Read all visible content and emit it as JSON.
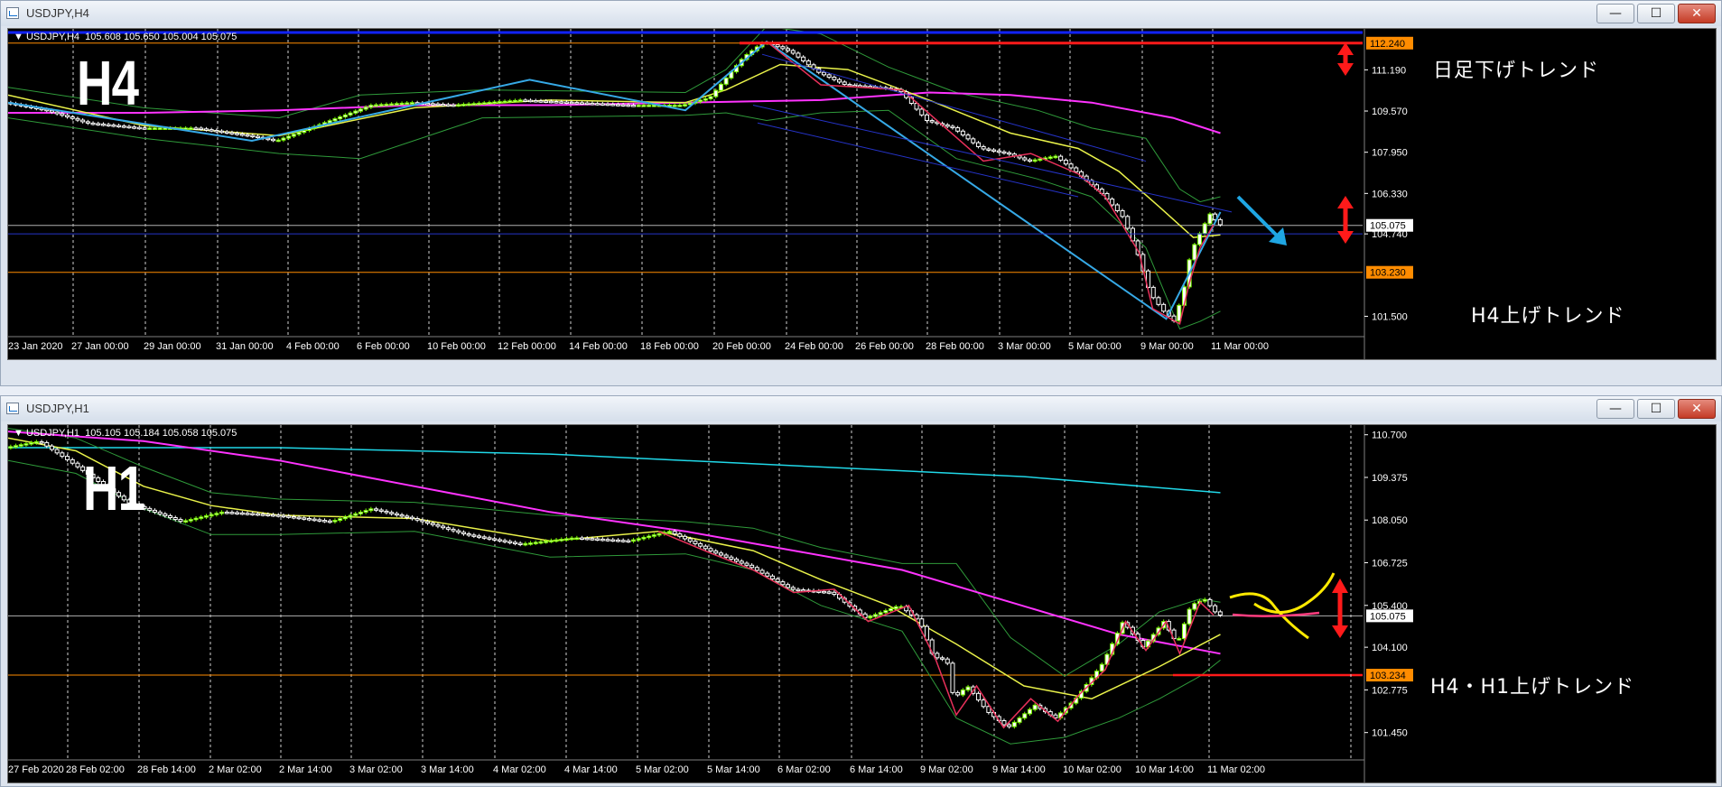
{
  "colors": {
    "background": "#000000",
    "price_up": "#7cfc00",
    "price_down": "#ffffff",
    "ma_fast": "#e9f24a",
    "ma_slow": "#ff33ff",
    "ma_long_h1": "#20d8e8",
    "bollinger": "#2f9a3a",
    "zigzag_h4": "#36a9e6",
    "zigzag_minor": "#e8305a",
    "channel": "#2533c8",
    "resistance": "#ff1a1a",
    "support": "#ff8c00",
    "current_price_line": "#b0b0b0",
    "annotation_arrow_red": "#ff1a1a",
    "annotation_arrow_blue": "#1fa6e3",
    "forecast_yellow": "#ffea00",
    "forecast_pink": "#ff3d7f"
  },
  "icons": {
    "app": "chart-window-icon",
    "minimize": "minimize-icon",
    "maximize": "maximize-icon",
    "close": "close-icon",
    "symbol_dropdown": "triangle-down-icon"
  },
  "windows": [
    {
      "id": "h4",
      "title": "USDJPY,H4",
      "symbol_line": "USDJPY,H4  105.608 105.650 105.004 105.075",
      "timeframe_label": "H4",
      "buttons": {
        "minimize": "—",
        "maximize": "☐",
        "close": "✕"
      },
      "price_axis": {
        "min": 100.7,
        "max": 112.8,
        "ticks": [
          "111.190",
          "109.570",
          "107.950",
          "106.330",
          "104.740",
          "101.500"
        ],
        "tick_values": [
          111.19,
          109.57,
          107.95,
          106.33,
          104.74,
          101.5
        ],
        "tags": [
          {
            "label": "112.240",
            "value": 112.24,
            "bg": "#ff8c00",
            "fg": "#000000"
          },
          {
            "label": "105.075",
            "value": 105.075,
            "bg": "#ffffff",
            "fg": "#000000"
          },
          {
            "label": "103.230",
            "value": 103.23,
            "bg": "#ff8c00",
            "fg": "#000000"
          }
        ]
      },
      "time_axis": [
        "23 Jan 2020",
        "27 Jan 00:00",
        "29 Jan 00:00",
        "31 Jan 00:00",
        "4 Feb 00:00",
        "6 Feb 00:00",
        "10 Feb 00:00",
        "12 Feb 00:00",
        "14 Feb 00:00",
        "18 Feb 00:00",
        "20 Feb 00:00",
        "24 Feb 00:00",
        "26 Feb 00:00",
        "28 Feb 00:00",
        "3 Mar 00:00",
        "5 Mar 00:00",
        "9 Mar 00:00",
        "11 Mar 00:00"
      ],
      "annotations": {
        "upper": "日足下げトレンド",
        "lower": "H4上げトレンド"
      },
      "levels": {
        "resistance": 112.24,
        "support": 103.23,
        "current": 105.075,
        "channel_line": 104.74
      },
      "price_path": [
        [
          0,
          109.9
        ],
        [
          0.03,
          109.6
        ],
        [
          0.06,
          109.1
        ],
        [
          0.1,
          108.9
        ],
        [
          0.14,
          108.9
        ],
        [
          0.18,
          108.6
        ],
        [
          0.2,
          108.4
        ],
        [
          0.24,
          109.2
        ],
        [
          0.27,
          109.8
        ],
        [
          0.3,
          109.9
        ],
        [
          0.33,
          109.8
        ],
        [
          0.38,
          110.0
        ],
        [
          0.42,
          109.9
        ],
        [
          0.46,
          109.8
        ],
        [
          0.5,
          109.8
        ],
        [
          0.52,
          110.1
        ],
        [
          0.545,
          111.7
        ],
        [
          0.56,
          112.3
        ],
        [
          0.58,
          111.9
        ],
        [
          0.6,
          111.1
        ],
        [
          0.62,
          110.6
        ],
        [
          0.645,
          110.5
        ],
        [
          0.66,
          110.4
        ],
        [
          0.68,
          109.2
        ],
        [
          0.7,
          108.9
        ],
        [
          0.72,
          108.1
        ],
        [
          0.74,
          107.9
        ],
        [
          0.755,
          107.6
        ],
        [
          0.775,
          107.8
        ],
        [
          0.79,
          107.2
        ],
        [
          0.81,
          106.3
        ],
        [
          0.825,
          105.4
        ],
        [
          0.835,
          104.1
        ],
        [
          0.845,
          102.4
        ],
        [
          0.855,
          101.7
        ],
        [
          0.863,
          101.3
        ],
        [
          0.87,
          102.6
        ],
        [
          0.875,
          104.0
        ],
        [
          0.882,
          104.8
        ],
        [
          0.89,
          105.6
        ],
        [
          0.895,
          105.1
        ]
      ],
      "ma_fast": [
        [
          0,
          110.2
        ],
        [
          0.1,
          109.0
        ],
        [
          0.2,
          108.6
        ],
        [
          0.3,
          109.7
        ],
        [
          0.4,
          110.0
        ],
        [
          0.5,
          109.9
        ],
        [
          0.53,
          110.4
        ],
        [
          0.57,
          111.4
        ],
        [
          0.62,
          111.2
        ],
        [
          0.68,
          110.0
        ],
        [
          0.74,
          108.7
        ],
        [
          0.79,
          108.1
        ],
        [
          0.82,
          107.2
        ],
        [
          0.85,
          105.8
        ],
        [
          0.875,
          104.6
        ],
        [
          0.895,
          104.7
        ]
      ],
      "ma_slow": [
        [
          0,
          109.5
        ],
        [
          0.1,
          109.5
        ],
        [
          0.2,
          109.6
        ],
        [
          0.3,
          109.8
        ],
        [
          0.4,
          109.8
        ],
        [
          0.5,
          109.9
        ],
        [
          0.6,
          110.0
        ],
        [
          0.68,
          110.3
        ],
        [
          0.74,
          110.2
        ],
        [
          0.8,
          109.9
        ],
        [
          0.86,
          109.3
        ],
        [
          0.895,
          108.7
        ]
      ],
      "bb_upper": [
        [
          0,
          110.5
        ],
        [
          0.1,
          109.7
        ],
        [
          0.2,
          109.3
        ],
        [
          0.26,
          110.2
        ],
        [
          0.35,
          110.4
        ],
        [
          0.5,
          110.3
        ],
        [
          0.53,
          111.2
        ],
        [
          0.56,
          112.9
        ],
        [
          0.6,
          112.6
        ],
        [
          0.65,
          111.3
        ],
        [
          0.7,
          110.3
        ],
        [
          0.76,
          109.6
        ],
        [
          0.8,
          108.9
        ],
        [
          0.84,
          108.5
        ],
        [
          0.865,
          106.5
        ],
        [
          0.88,
          106.0
        ],
        [
          0.895,
          106.2
        ]
      ],
      "bb_lower": [
        [
          0,
          109.3
        ],
        [
          0.1,
          108.5
        ],
        [
          0.2,
          107.9
        ],
        [
          0.26,
          107.7
        ],
        [
          0.35,
          109.3
        ],
        [
          0.5,
          109.4
        ],
        [
          0.53,
          109.5
        ],
        [
          0.56,
          109.2
        ],
        [
          0.6,
          109.5
        ],
        [
          0.65,
          109.6
        ],
        [
          0.7,
          107.7
        ],
        [
          0.76,
          106.9
        ],
        [
          0.8,
          106.2
        ],
        [
          0.84,
          104.2
        ],
        [
          0.865,
          101.0
        ],
        [
          0.88,
          101.3
        ],
        [
          0.895,
          101.7
        ]
      ],
      "zigzag": [
        [
          0,
          109.9
        ],
        [
          0.18,
          108.4
        ],
        [
          0.385,
          110.8
        ],
        [
          0.5,
          109.6
        ],
        [
          0.56,
          112.3
        ],
        [
          0.855,
          101.4
        ],
        [
          0.895,
          105.6
        ]
      ],
      "zigzag_minor": [
        [
          0.56,
          112.3
        ],
        [
          0.6,
          110.6
        ],
        [
          0.66,
          110.4
        ],
        [
          0.72,
          107.6
        ],
        [
          0.755,
          107.9
        ],
        [
          0.79,
          107.1
        ],
        [
          0.81,
          106.2
        ],
        [
          0.835,
          104.0
        ],
        [
          0.845,
          101.8
        ],
        [
          0.865,
          101.2
        ],
        [
          0.872,
          102.8
        ],
        [
          0.88,
          104.2
        ],
        [
          0.89,
          105.1
        ]
      ]
    },
    {
      "id": "h1",
      "title": "USDJPY,H1",
      "symbol_line": "USDJPY,H1  105.105 105.184 105.058 105.075",
      "timeframe_label": "H1",
      "buttons": {
        "minimize": "—",
        "maximize": "☐",
        "close": "✕"
      },
      "price_axis": {
        "min": 100.6,
        "max": 111.0,
        "ticks": [
          "110.700",
          "109.375",
          "108.050",
          "106.725",
          "105.400",
          "104.100",
          "102.775",
          "101.450"
        ],
        "tick_values": [
          110.7,
          109.375,
          108.05,
          106.725,
          105.4,
          104.1,
          102.775,
          101.45
        ],
        "tags": [
          {
            "label": "105.075",
            "value": 105.075,
            "bg": "#ffffff",
            "fg": "#000000"
          },
          {
            "label": "103.234",
            "value": 103.234,
            "bg": "#ff8c00",
            "fg": "#000000"
          }
        ]
      },
      "time_axis": [
        "27 Feb 2020",
        "28 Feb 02:00",
        "28 Feb 14:00",
        "2 Mar 02:00",
        "2 Mar 14:00",
        "3 Mar 02:00",
        "3 Mar 14:00",
        "4 Mar 02:00",
        "4 Mar 14:00",
        "5 Mar 02:00",
        "5 Mar 14:00",
        "6 Mar 02:00",
        "6 Mar 14:00",
        "9 Mar 02:00",
        "9 Mar 14:00",
        "10 Mar 02:00",
        "10 Mar 14:00",
        "11 Mar 02:00"
      ],
      "annotations": {
        "lower": "H4・H1上げトレンド"
      },
      "levels": {
        "support": 103.234,
        "current": 105.075
      },
      "price_path": [
        [
          0,
          110.3
        ],
        [
          0.025,
          110.5
        ],
        [
          0.05,
          109.8
        ],
        [
          0.09,
          108.6
        ],
        [
          0.13,
          108.0
        ],
        [
          0.16,
          108.3
        ],
        [
          0.2,
          108.2
        ],
        [
          0.24,
          108.0
        ],
        [
          0.27,
          108.4
        ],
        [
          0.3,
          108.1
        ],
        [
          0.34,
          107.6
        ],
        [
          0.38,
          107.3
        ],
        [
          0.42,
          107.5
        ],
        [
          0.46,
          107.4
        ],
        [
          0.49,
          107.7
        ],
        [
          0.52,
          107.1
        ],
        [
          0.55,
          106.6
        ],
        [
          0.58,
          105.9
        ],
        [
          0.61,
          105.8
        ],
        [
          0.635,
          105.0
        ],
        [
          0.66,
          105.4
        ],
        [
          0.675,
          104.9
        ],
        [
          0.685,
          103.8
        ],
        [
          0.695,
          103.7
        ],
        [
          0.7,
          102.5
        ],
        [
          0.71,
          102.9
        ],
        [
          0.725,
          102.1
        ],
        [
          0.74,
          101.6
        ],
        [
          0.76,
          102.3
        ],
        [
          0.775,
          101.9
        ],
        [
          0.79,
          102.5
        ],
        [
          0.81,
          103.6
        ],
        [
          0.825,
          104.9
        ],
        [
          0.84,
          104.1
        ],
        [
          0.855,
          104.9
        ],
        [
          0.865,
          104.2
        ],
        [
          0.875,
          105.4
        ],
        [
          0.885,
          105.6
        ],
        [
          0.895,
          105.1
        ]
      ],
      "ma_fast": [
        [
          0,
          110.6
        ],
        [
          0.05,
          110.2
        ],
        [
          0.1,
          109.1
        ],
        [
          0.15,
          108.5
        ],
        [
          0.2,
          108.2
        ],
        [
          0.3,
          108.1
        ],
        [
          0.4,
          107.4
        ],
        [
          0.48,
          107.7
        ],
        [
          0.55,
          107.1
        ],
        [
          0.6,
          106.2
        ],
        [
          0.65,
          105.4
        ],
        [
          0.7,
          104.2
        ],
        [
          0.75,
          102.9
        ],
        [
          0.8,
          102.5
        ],
        [
          0.85,
          103.5
        ],
        [
          0.895,
          104.5
        ]
      ],
      "ma_slow": [
        [
          0,
          110.8
        ],
        [
          0.1,
          110.5
        ],
        [
          0.2,
          109.9
        ],
        [
          0.3,
          109.1
        ],
        [
          0.4,
          108.3
        ],
        [
          0.5,
          107.7
        ],
        [
          0.58,
          107.1
        ],
        [
          0.66,
          106.5
        ],
        [
          0.74,
          105.5
        ],
        [
          0.82,
          104.5
        ],
        [
          0.895,
          103.9
        ]
      ],
      "ma_long": [
        [
          0,
          110.3
        ],
        [
          0.2,
          110.3
        ],
        [
          0.4,
          110.1
        ],
        [
          0.6,
          109.7
        ],
        [
          0.75,
          109.4
        ],
        [
          0.895,
          108.9
        ]
      ],
      "bb_upper": [
        [
          0,
          110.9
        ],
        [
          0.05,
          110.6
        ],
        [
          0.1,
          109.7
        ],
        [
          0.15,
          108.9
        ],
        [
          0.2,
          108.7
        ],
        [
          0.3,
          108.6
        ],
        [
          0.4,
          108.2
        ],
        [
          0.5,
          108.0
        ],
        [
          0.55,
          107.8
        ],
        [
          0.6,
          107.2
        ],
        [
          0.66,
          106.7
        ],
        [
          0.7,
          106.7
        ],
        [
          0.74,
          104.4
        ],
        [
          0.78,
          103.2
        ],
        [
          0.82,
          104.2
        ],
        [
          0.85,
          105.2
        ],
        [
          0.88,
          105.6
        ],
        [
          0.895,
          105.5
        ]
      ],
      "bb_lower": [
        [
          0,
          109.9
        ],
        [
          0.05,
          109.5
        ],
        [
          0.1,
          108.4
        ],
        [
          0.15,
          107.6
        ],
        [
          0.2,
          107.6
        ],
        [
          0.3,
          107.7
        ],
        [
          0.4,
          106.9
        ],
        [
          0.5,
          107.0
        ],
        [
          0.55,
          106.5
        ],
        [
          0.6,
          105.4
        ],
        [
          0.66,
          104.6
        ],
        [
          0.7,
          101.9
        ],
        [
          0.74,
          101.1
        ],
        [
          0.78,
          101.3
        ],
        [
          0.82,
          101.9
        ],
        [
          0.85,
          102.5
        ],
        [
          0.88,
          103.2
        ],
        [
          0.895,
          103.7
        ]
      ],
      "zigzag_minor": [
        [
          0.48,
          107.7
        ],
        [
          0.52,
          107.0
        ],
        [
          0.55,
          106.5
        ],
        [
          0.58,
          105.8
        ],
        [
          0.61,
          105.9
        ],
        [
          0.635,
          104.9
        ],
        [
          0.665,
          105.4
        ],
        [
          0.685,
          103.7
        ],
        [
          0.7,
          102.0
        ],
        [
          0.715,
          102.9
        ],
        [
          0.735,
          101.6
        ],
        [
          0.755,
          102.5
        ],
        [
          0.775,
          101.8
        ],
        [
          0.79,
          102.6
        ],
        [
          0.81,
          103.4
        ],
        [
          0.825,
          104.9
        ],
        [
          0.84,
          104.0
        ],
        [
          0.855,
          104.9
        ],
        [
          0.865,
          103.9
        ],
        [
          0.88,
          105.5
        ],
        [
          0.89,
          105.1
        ]
      ]
    }
  ]
}
